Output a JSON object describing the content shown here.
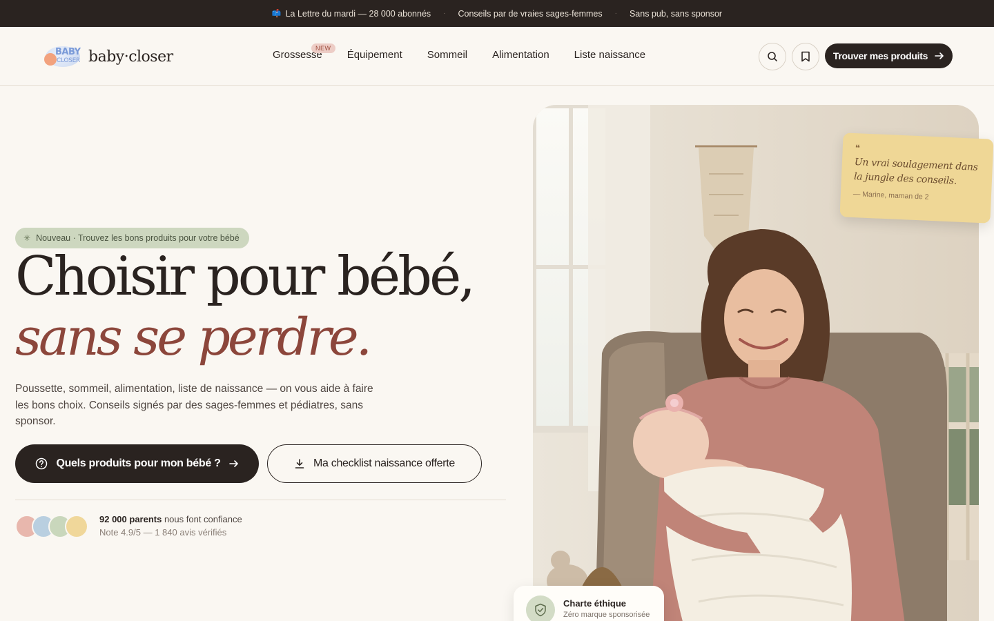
{
  "topbar": {
    "item1": "La Lettre du mardi — 28 000 abonnés",
    "item2": "Conseils par de vraies sages-femmes",
    "item3": "Sans pub, sans sponsor",
    "separator": "·"
  },
  "brand": {
    "logo_line1": "BABY",
    "logo_line2": "CLOSER",
    "name": "baby·closer"
  },
  "nav": {
    "items": [
      {
        "label": "Grossesse",
        "badge": "NEW"
      },
      {
        "label": "Équipement"
      },
      {
        "label": "Sommeil"
      },
      {
        "label": "Alimentation"
      },
      {
        "label": "Liste naissance"
      }
    ]
  },
  "header_actions": {
    "search_icon": "search-icon",
    "bookmark_icon": "bookmark-icon",
    "cta_label": "Trouver mes produits"
  },
  "hero": {
    "pill": "Nouveau · Trouvez les bons produits pour votre bébé",
    "title_line1": "Choisir pour bébé,",
    "title_line2": "sans se perdre.",
    "lead": "Poussette, sommeil, alimentation, liste de naissance — on vous aide à faire les bons choix. Conseils signés par des sages-femmes et pédiatres, sans sponsor.",
    "primary_cta": "Quels produits pour mon bébé ?",
    "secondary_cta": "Ma checklist naissance offerte",
    "social_strong": "92 000 parents",
    "social_rest": " nous font confiance",
    "rating": "Note 4.9/5 — 1 840 avis vérifiés"
  },
  "quote": {
    "mark": "❝",
    "text": "Un vrai soulagement dans la jungle des conseils.",
    "author": "— Marine, maman de 2"
  },
  "charte": {
    "title": "Charte éthique",
    "subtitle": "Zéro marque sponsorisée"
  },
  "colors": {
    "background": "#faf7f2",
    "dark": "#2a2320",
    "accent_red": "#8c463b",
    "pill_green": "#cdd7bf",
    "quote_yellow": "#efd796",
    "avatar_colors": [
      "#e8b7ad",
      "#b9cfe0",
      "#c9d7bc",
      "#f0d79a"
    ]
  }
}
